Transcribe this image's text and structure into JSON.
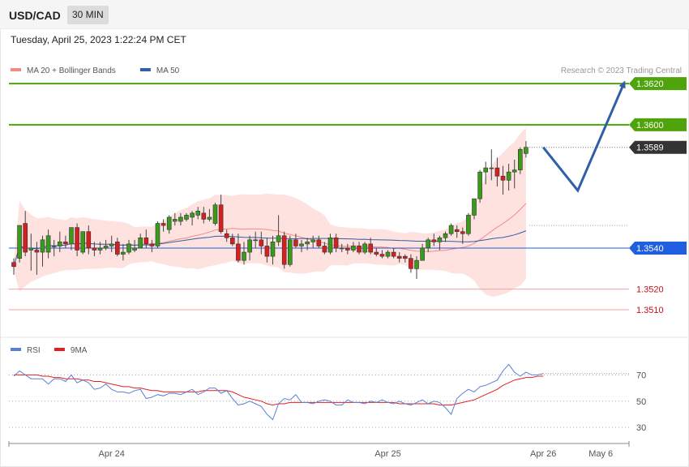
{
  "header": {
    "symbol": "USD/CAD",
    "timeframe": "30 MIN"
  },
  "datetime": "Tuesday, April 25, 2023 1:22:24 PM CET",
  "copyright": "Research © 2023 Trading Central",
  "legend_main": [
    {
      "label": "MA 20 + Bollinger Bands",
      "color": "#f28b82"
    },
    {
      "label": "MA 50",
      "color": "#2f5fa6"
    }
  ],
  "legend_rsi": [
    {
      "label": "RSI",
      "color": "#5b7fd6"
    },
    {
      "label": "9MA",
      "color": "#e02020"
    }
  ],
  "chart_data": [
    {
      "type": "candlestick",
      "ylim": [
        1.3497,
        1.3637
      ],
      "x_ticks": [
        {
          "label": "Apr 24",
          "index": 17
        },
        {
          "label": "Apr 25",
          "index": 65
        },
        {
          "label": "Apr 26",
          "index": 92
        },
        {
          "label": "May 6",
          "index": 102
        }
      ],
      "levels": [
        {
          "label": "1.3620",
          "value": 1.362,
          "kind": "resistance",
          "color": "#4fa30b"
        },
        {
          "label": "1.3600",
          "value": 1.36,
          "kind": "resistance",
          "color": "#4fa30b"
        },
        {
          "label": "1.3589",
          "value": 1.3589,
          "kind": "current",
          "color": "#333333"
        },
        {
          "label": "1.3540",
          "value": 1.354,
          "kind": "pivot",
          "color": "#1f5fe0"
        },
        {
          "label": "1.3520",
          "value": 1.352,
          "kind": "support",
          "color": "#e05050"
        },
        {
          "label": "1.3510",
          "value": 1.351,
          "kind": "support",
          "color": "#e05050"
        }
      ],
      "forecast_path": [
        {
          "i": 92,
          "v": 1.3589
        },
        {
          "i": 98,
          "v": 1.3568
        },
        {
          "i": 106,
          "v": 1.362
        }
      ],
      "candles": [
        [
          1.3533,
          1.3535,
          1.3527,
          1.3531
        ],
        [
          1.3535,
          1.3551,
          1.3533,
          1.3551
        ],
        [
          1.3552,
          1.3558,
          1.3536,
          1.3538
        ],
        [
          1.3539,
          1.3547,
          1.3529,
          1.354
        ],
        [
          1.3539,
          1.3543,
          1.3527,
          1.3538
        ],
        [
          1.3538,
          1.3546,
          1.3531,
          1.3544
        ],
        [
          1.3538,
          1.3549,
          1.3535,
          1.3546
        ],
        [
          1.3541,
          1.3544,
          1.3536,
          1.3541
        ],
        [
          1.3541,
          1.3548,
          1.3538,
          1.3543
        ],
        [
          1.3543,
          1.3546,
          1.354,
          1.3542
        ],
        [
          1.3542,
          1.355,
          1.3539,
          1.355
        ],
        [
          1.355,
          1.3552,
          1.3536,
          1.3539
        ],
        [
          1.3538,
          1.3548,
          1.3537,
          1.3548
        ],
        [
          1.3548,
          1.3551,
          1.3537,
          1.354
        ],
        [
          1.354,
          1.3543,
          1.3536,
          1.3539
        ],
        [
          1.3539,
          1.3543,
          1.3537,
          1.354
        ],
        [
          1.354,
          1.3544,
          1.3539,
          1.3541
        ],
        [
          1.3541,
          1.3546,
          1.3538,
          1.3542
        ],
        [
          1.3543,
          1.3545,
          1.3536,
          1.3537
        ],
        [
          1.3537,
          1.3542,
          1.3534,
          1.3538
        ],
        [
          1.3538,
          1.3544,
          1.3537,
          1.3542
        ],
        [
          1.3539,
          1.3544,
          1.3538,
          1.354
        ],
        [
          1.354,
          1.3547,
          1.354,
          1.3545
        ],
        [
          1.3545,
          1.3549,
          1.354,
          1.3542
        ],
        [
          1.3542,
          1.3544,
          1.3538,
          1.3541
        ],
        [
          1.3541,
          1.3553,
          1.354,
          1.3552
        ],
        [
          1.3552,
          1.3554,
          1.3548,
          1.3551
        ],
        [
          1.3549,
          1.3556,
          1.3547,
          1.3555
        ],
        [
          1.3553,
          1.3557,
          1.3551,
          1.3554
        ],
        [
          1.3553,
          1.3557,
          1.3551,
          1.3555
        ],
        [
          1.3554,
          1.3557,
          1.3553,
          1.3556
        ],
        [
          1.3555,
          1.3558,
          1.3551,
          1.3557
        ],
        [
          1.3556,
          1.356,
          1.3554,
          1.3558
        ],
        [
          1.3557,
          1.356,
          1.3552,
          1.3554
        ],
        [
          1.3554,
          1.3559,
          1.3553,
          1.3555
        ],
        [
          1.3552,
          1.3562,
          1.3551,
          1.3561
        ],
        [
          1.3561,
          1.3566,
          1.3547,
          1.3548
        ],
        [
          1.3547,
          1.3549,
          1.3543,
          1.3545
        ],
        [
          1.3545,
          1.3547,
          1.3541,
          1.3542
        ],
        [
          1.3542,
          1.3547,
          1.3533,
          1.3534
        ],
        [
          1.3534,
          1.3543,
          1.3532,
          1.3538
        ],
        [
          1.3538,
          1.3546,
          1.3534,
          1.3544
        ],
        [
          1.3544,
          1.3548,
          1.354,
          1.3544
        ],
        [
          1.3544,
          1.3548,
          1.3537,
          1.3541
        ],
        [
          1.3541,
          1.3545,
          1.3533,
          1.3536
        ],
        [
          1.3536,
          1.3546,
          1.3532,
          1.3543
        ],
        [
          1.3543,
          1.3556,
          1.3541,
          1.3546
        ],
        [
          1.3546,
          1.3548,
          1.353,
          1.3532
        ],
        [
          1.3532,
          1.3546,
          1.3531,
          1.3544
        ],
        [
          1.3544,
          1.3547,
          1.354,
          1.3541
        ],
        [
          1.3541,
          1.3544,
          1.3538,
          1.3542
        ],
        [
          1.3542,
          1.3545,
          1.3539,
          1.3543
        ],
        [
          1.3543,
          1.3546,
          1.354,
          1.3544
        ],
        [
          1.3544,
          1.3546,
          1.354,
          1.3541
        ],
        [
          1.3541,
          1.3543,
          1.3537,
          1.3538
        ],
        [
          1.3538,
          1.3547,
          1.3537,
          1.3545
        ],
        [
          1.3545,
          1.3547,
          1.3538,
          1.354
        ],
        [
          1.354,
          1.3542,
          1.3538,
          1.354
        ],
        [
          1.354,
          1.3542,
          1.3537,
          1.3539
        ],
        [
          1.3539,
          1.3543,
          1.3538,
          1.3541
        ],
        [
          1.3541,
          1.3543,
          1.3537,
          1.3538
        ],
        [
          1.3538,
          1.3543,
          1.3537,
          1.3542
        ],
        [
          1.3542,
          1.3545,
          1.3537,
          1.3538
        ],
        [
          1.3538,
          1.354,
          1.3536,
          1.3537
        ],
        [
          1.3537,
          1.3539,
          1.3535,
          1.3536
        ],
        [
          1.3536,
          1.3539,
          1.3535,
          1.3538
        ],
        [
          1.3538,
          1.354,
          1.3535,
          1.3536
        ],
        [
          1.3536,
          1.3538,
          1.3533,
          1.3535
        ],
        [
          1.3536,
          1.3537,
          1.3533,
          1.3535
        ],
        [
          1.3535,
          1.3537,
          1.3528,
          1.353
        ],
        [
          1.353,
          1.3536,
          1.3525,
          1.3534
        ],
        [
          1.3534,
          1.3542,
          1.3534,
          1.354
        ],
        [
          1.354,
          1.3545,
          1.3538,
          1.3544
        ],
        [
          1.3544,
          1.3547,
          1.3541,
          1.3543
        ],
        [
          1.3543,
          1.3546,
          1.3539,
          1.3545
        ],
        [
          1.3545,
          1.3548,
          1.3543,
          1.3547
        ],
        [
          1.3547,
          1.3552,
          1.3546,
          1.3551
        ],
        [
          1.3549,
          1.3551,
          1.3545,
          1.3548
        ],
        [
          1.3548,
          1.355,
          1.3542,
          1.3547
        ],
        [
          1.3547,
          1.3557,
          1.3546,
          1.3556
        ],
        [
          1.3556,
          1.3564,
          1.3554,
          1.3564
        ],
        [
          1.3564,
          1.3578,
          1.3562,
          1.3577
        ],
        [
          1.3577,
          1.3582,
          1.3571,
          1.3579
        ],
        [
          1.3579,
          1.3588,
          1.3573,
          1.3579
        ],
        [
          1.3579,
          1.3584,
          1.357,
          1.3575
        ],
        [
          1.3575,
          1.358,
          1.3566,
          1.3573
        ],
        [
          1.3573,
          1.3581,
          1.3568,
          1.3577
        ],
        [
          1.3577,
          1.3583,
          1.3569,
          1.3578
        ],
        [
          1.3578,
          1.3589,
          1.3576,
          1.3588
        ],
        [
          1.3586,
          1.3592,
          1.3584,
          1.3589
        ]
      ]
    },
    {
      "type": "line",
      "title": "RSI",
      "ylim": [
        19,
        98
      ],
      "y_ticks": [
        70,
        50,
        30
      ],
      "series": [
        {
          "name": "RSI",
          "values": [
            69,
            73,
            70,
            67,
            67,
            67,
            63,
            67,
            67,
            65,
            70,
            64,
            66,
            64,
            59,
            60,
            63,
            59,
            57,
            57,
            56,
            58,
            59,
            52,
            53,
            55,
            54,
            56,
            56,
            55,
            57,
            59,
            55,
            57,
            60,
            60,
            56,
            58,
            52,
            47,
            48,
            50,
            48,
            46,
            40,
            36,
            48,
            52,
            51,
            55,
            49,
            49,
            48,
            50,
            51,
            50,
            47,
            47,
            51,
            49,
            49,
            48,
            50,
            49,
            51,
            49,
            48,
            50,
            48,
            47,
            49,
            51,
            48,
            50,
            49,
            45,
            40,
            52,
            56,
            59,
            57,
            61,
            62,
            64,
            66,
            73,
            78,
            72,
            69,
            72,
            70,
            70,
            71
          ]
        },
        {
          "name": "9MA",
          "values": [
            70,
            70,
            70,
            70,
            70,
            69,
            69,
            68,
            68,
            67,
            67,
            67,
            66,
            66,
            65,
            65,
            64,
            63,
            62,
            61,
            61,
            60,
            60,
            59,
            58,
            58,
            57,
            57,
            57,
            57,
            57,
            57,
            57,
            58,
            58,
            58,
            58,
            58,
            57,
            55,
            53,
            52,
            51,
            50,
            48,
            47,
            48,
            48,
            49,
            49,
            49,
            49,
            49,
            49,
            49,
            49,
            49,
            49,
            49,
            49,
            49,
            49,
            49,
            49,
            49,
            49,
            49,
            48,
            48,
            48,
            48,
            48,
            48,
            48,
            47,
            47,
            47,
            48,
            49,
            50,
            51,
            53,
            55,
            57,
            59,
            62,
            64,
            66,
            67,
            68,
            68,
            69,
            69
          ]
        }
      ]
    }
  ]
}
